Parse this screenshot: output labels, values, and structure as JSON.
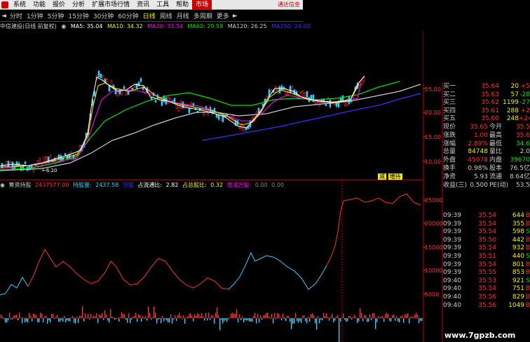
{
  "menu": {
    "items": [
      "系统",
      "功能",
      "报价",
      "分析",
      "扩展市场行情",
      "资讯",
      "工具",
      "帮助"
    ],
    "active_item": "市场",
    "brand": "通达信金"
  },
  "periods": {
    "items": [
      "分时",
      "1分钟",
      "5分钟",
      "15分钟",
      "30分钟",
      "60分钟",
      "日线",
      "周线",
      "月线",
      "多周期",
      "更多"
    ],
    "active": "日线",
    "nav_left": "◄",
    "nav_right": "►"
  },
  "ma_legend": {
    "stock": "中信建投(日线 前复权)",
    "ma5": "MA5: 35.04",
    "ma10": "MA10: 34.32",
    "ma20": "MA20: 33.34",
    "ma60": "MA60: 29.59",
    "ma120": "MA120: 26.25",
    "ma250": "MA250: 24.00"
  },
  "indicator_legend": {
    "name": "筹资持股",
    "v1": "2437577.00",
    "hold_label": "持股量:",
    "hold_value": "2437.58",
    "hold_unit": "万股",
    "flow_label": "占流通比:",
    "flow_value": "2.82",
    "total_label": "占总股比:",
    "total_value": "0.32",
    "delta_label": "增减万股:",
    "delta_value": "0.00",
    "tail": "0.00"
  },
  "price_axis": [
    "25.00",
    "20.00",
    "15.00",
    "10.00"
  ],
  "volume_axis": [
    "25000",
    "20000",
    "15000",
    "10000",
    "5000"
  ],
  "low_label": "6.20",
  "sign": {
    "a": "減",
    "b": "増持"
  },
  "order_book": [
    {
      "label": "买一",
      "price": "35.64",
      "vol": "20",
      "chg": "+5"
    },
    {
      "label": "买二",
      "price": "35.63",
      "vol": "57",
      "chg": "-28"
    },
    {
      "label": "买三",
      "price": "35.62",
      "vol": "1199",
      "chg": "-27"
    },
    {
      "label": "买四",
      "price": "35.61",
      "vol": "288",
      "chg": "+2"
    },
    {
      "label": "买五",
      "price": "35.60",
      "vol": "248",
      "chg": "+24"
    }
  ],
  "stats": [
    {
      "l1": "现价",
      "v1": "35.65",
      "l2": "今开",
      "v2": "35.5"
    },
    {
      "l1": "涨跌",
      "v1": "1.00",
      "l2": "最高",
      "v2": "35.6"
    },
    {
      "l1": "涨幅",
      "v1": "2.89%",
      "l2": "最低",
      "v2": "34.6"
    },
    {
      "l1": "总量",
      "v1": "84748",
      "l2": "量比",
      "v2": "2.0"
    },
    {
      "l1": "外盘",
      "v1": "45078",
      "l2": "内盘",
      "v2": "39670"
    },
    {
      "l1": "换手",
      "v1": "0.98%",
      "l2": "股本",
      "v2": "76.5亿"
    },
    {
      "l1": "净资",
      "v1": "5.93",
      "l2": "流通",
      "v2": "8.64亿"
    },
    {
      "l1": "收益(三)",
      "v1": "0.500",
      "l2": "PE(动)",
      "v2": "53.5"
    }
  ],
  "ticks": [
    {
      "t": "09:39",
      "p": "35.54",
      "v": "644",
      "d": "B"
    },
    {
      "t": "09:39",
      "p": "35.54",
      "v": "355",
      "d": "B"
    },
    {
      "t": "09:39",
      "p": "35.54",
      "v": "598",
      "d": "S"
    },
    {
      "t": "09:39",
      "p": "35.50",
      "v": "442",
      "d": "B"
    },
    {
      "t": "09:39",
      "p": "35.54",
      "v": "932",
      "d": "B"
    },
    {
      "t": "09:39",
      "p": "35.51",
      "v": "440",
      "d": "S"
    },
    {
      "t": "09:39",
      "p": "35.54",
      "v": "801",
      "d": "B"
    },
    {
      "t": "09:39",
      "p": "35.55",
      "v": "853",
      "d": "B"
    },
    {
      "t": "09:40",
      "p": "35.53",
      "v": "921",
      "d": "S"
    },
    {
      "t": "09:40",
      "p": "35.54",
      "v": "751",
      "d": "B"
    },
    {
      "t": "09:40",
      "p": "35.56",
      "v": "829",
      "d": "B"
    },
    {
      "t": "09:40",
      "p": "35.56",
      "v": "1049",
      "d": "B"
    }
  ],
  "watermark": "www.7gpzb.com",
  "colors": {
    "red": "#ff3030",
    "green": "#00e000",
    "yellow": "#f0f000",
    "cyan": "#33ccff",
    "ma5": "#ffffff",
    "ma10": "#f0f000",
    "ma20": "#ff00ff",
    "ma60": "#00e000",
    "ma120": "#cccccc",
    "ma250": "#3333ff"
  }
}
